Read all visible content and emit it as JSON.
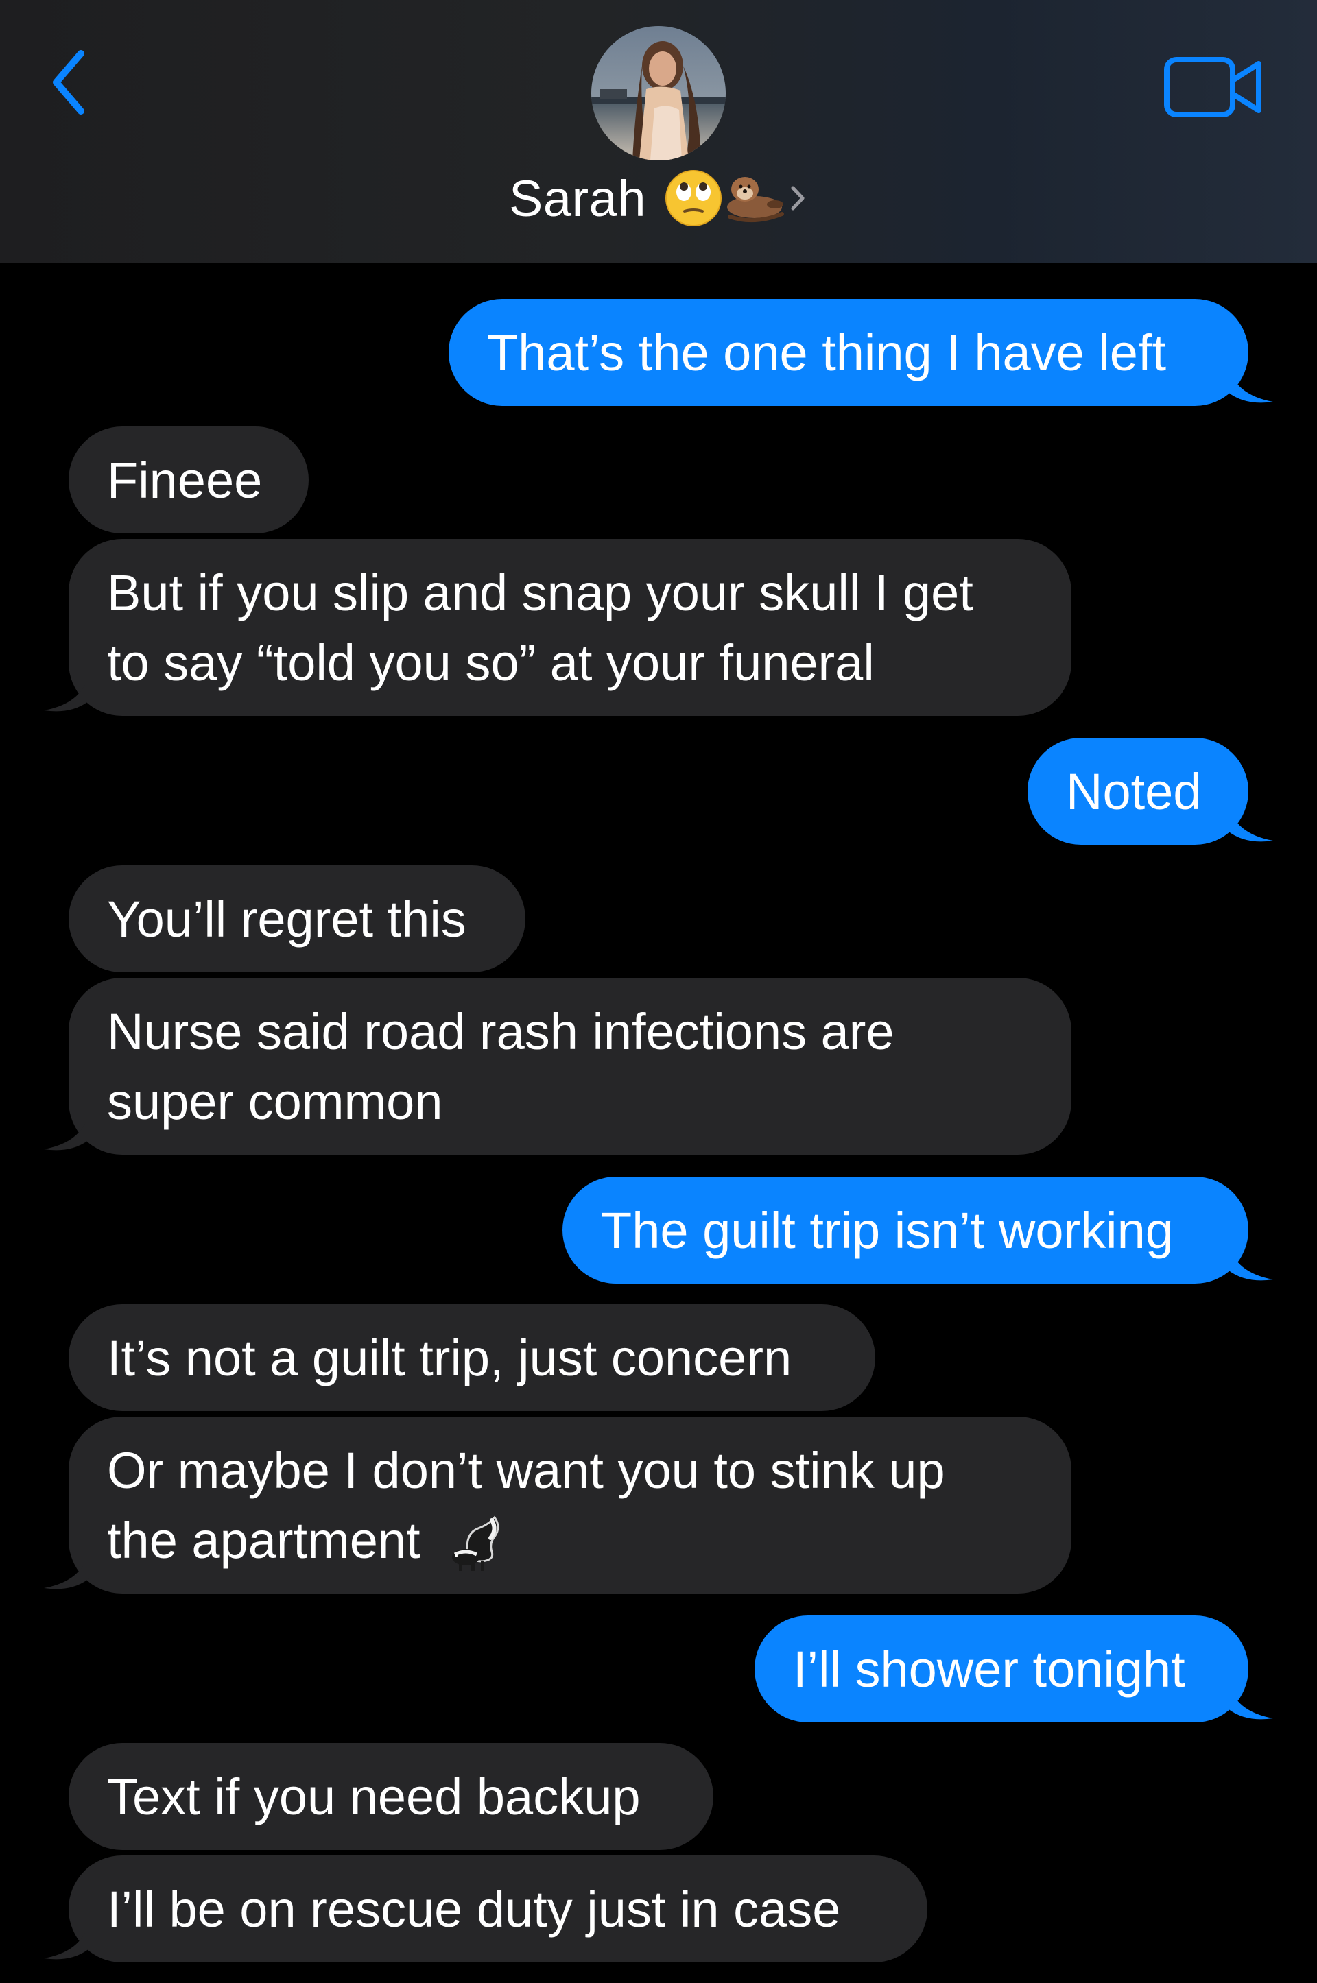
{
  "header": {
    "contact_name": "Sarah",
    "name_emojis": [
      "face-with-rolling-eyes-emoji",
      "otter-emoji"
    ],
    "back_icon": "chevron-left-icon",
    "video_icon": "video-camera-icon",
    "chevron_icon": "chevron-right-icon",
    "accent_color": "#0a84ff"
  },
  "messages": [
    {
      "direction": "out",
      "text": "That’s the one thing I have left"
    },
    {
      "direction": "in",
      "text": "Fineee"
    },
    {
      "direction": "in",
      "line1": "But if you slip and snap your skull I get",
      "line2": "to say “told you so” at your funeral"
    },
    {
      "direction": "out",
      "text": "Noted"
    },
    {
      "direction": "in",
      "text": "You’ll regret this"
    },
    {
      "direction": "in",
      "line1": "Nurse said road rash infections are",
      "line2": "super common"
    },
    {
      "direction": "out",
      "text": "The guilt trip isn’t working"
    },
    {
      "direction": "in",
      "text": "It’s not a guilt trip, just concern"
    },
    {
      "direction": "in",
      "line1": "Or maybe I don’t want you to stink up",
      "line2": "the apartment",
      "emoji": "skunk-emoji"
    },
    {
      "direction": "out",
      "text": "I’ll shower tonight"
    },
    {
      "direction": "in",
      "text": "Text if you need backup"
    },
    {
      "direction": "in",
      "text": "I’ll be on rescue duty just in case"
    }
  ],
  "colors": {
    "outgoing_bubble": "#0a84ff",
    "incoming_bubble": "#262628",
    "background": "#000000"
  }
}
